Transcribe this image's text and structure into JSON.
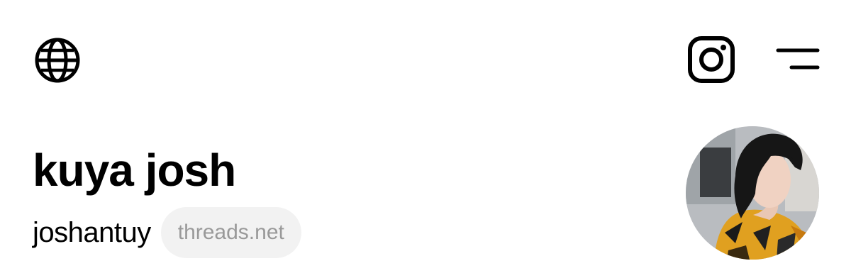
{
  "header": {
    "left_icon": "globe-icon",
    "right_icons": [
      "instagram-icon",
      "menu-icon"
    ]
  },
  "profile": {
    "display_name": "kuya josh",
    "username": "joshantuy",
    "domain_badge": "threads.net",
    "avatar_alt": "kuya josh"
  },
  "colors": {
    "background": "#ffffff",
    "text_primary": "#000000",
    "badge_bg": "#f2f2f2",
    "badge_text": "#999999"
  }
}
